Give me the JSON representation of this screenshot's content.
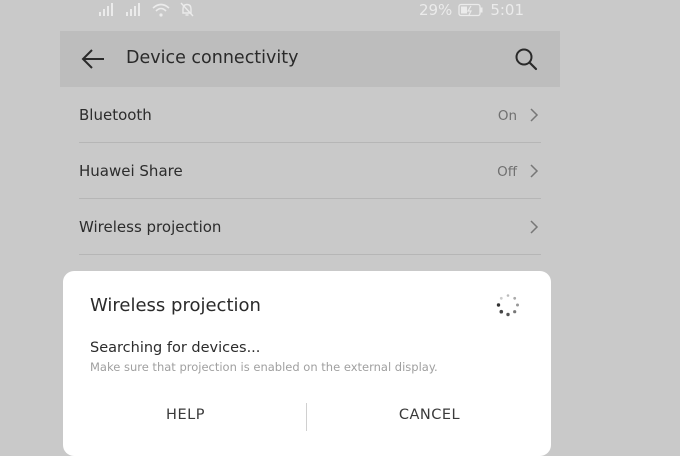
{
  "status_bar": {
    "battery_percent": "29%",
    "time": "5:01"
  },
  "toolbar": {
    "title": "Device connectivity",
    "back_icon": "arrow-left-icon",
    "search_icon": "search-icon"
  },
  "settings": [
    {
      "label": "Bluetooth",
      "value": "On"
    },
    {
      "label": "Huawei Share",
      "value": "Off"
    },
    {
      "label": "Wireless projection",
      "value": ""
    }
  ],
  "dialog": {
    "title": "Wireless projection",
    "message": "Searching for devices...",
    "hint": "Make sure that projection is enabled on the external display.",
    "help_label": "HELP",
    "cancel_label": "CANCEL"
  },
  "colors": {
    "background": "#c9c9c9",
    "toolbar": "#bdbdbd",
    "dialog": "#ffffff"
  }
}
